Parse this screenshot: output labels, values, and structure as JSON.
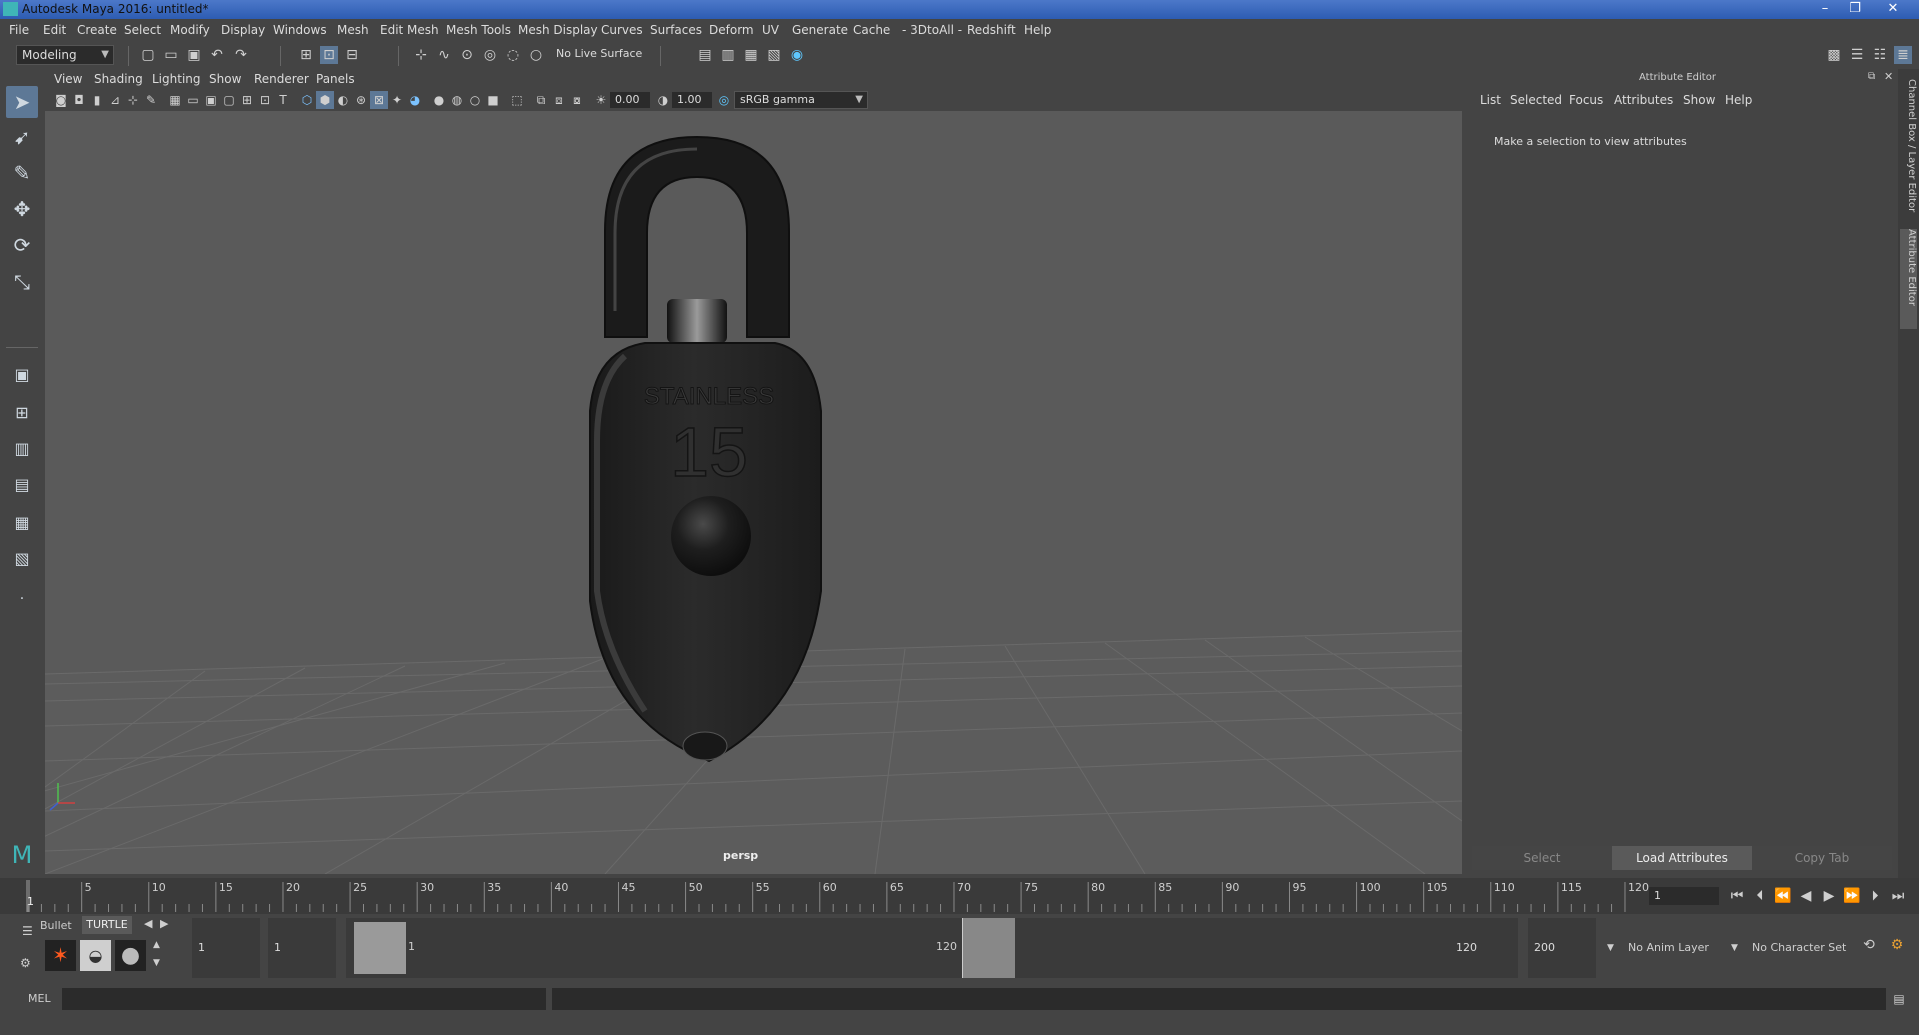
{
  "window": {
    "title": "Autodesk Maya 2016: untitled*",
    "minimize": "–",
    "restore": "❐",
    "close": "✕"
  },
  "menubar": {
    "items": [
      "File",
      "Edit",
      "Create",
      "Select",
      "Modify",
      "Display",
      "Windows",
      "Mesh",
      "Edit Mesh",
      "Mesh Tools",
      "Mesh Display",
      "Curves",
      "Surfaces",
      "Deform",
      "UV",
      "Generate",
      "Cache",
      "- 3DtoAll -",
      "Redshift",
      "Help"
    ]
  },
  "statusline": {
    "mode": "Modeling",
    "live_surface": "No Live Surface"
  },
  "panel": {
    "menus": [
      "View",
      "Shading",
      "Lighting",
      "Show",
      "Renderer",
      "Panels"
    ],
    "exposure": "0.00",
    "gamma": "1.00",
    "color_space": "sRGB gamma",
    "camera_label": "persp"
  },
  "model": {
    "text_line1": "STAINLESS",
    "text_line2": "15"
  },
  "attribute_editor": {
    "header": "Attribute Editor",
    "tabs": [
      "List",
      "Selected",
      "Focus",
      "Attributes",
      "Show",
      "Help"
    ],
    "message": "Make a selection to view attributes",
    "buttons": {
      "select": "Select",
      "load": "Load Attributes",
      "copy": "Copy Tab"
    }
  },
  "side_tabs": {
    "channel_box": "Channel Box / Layer Editor",
    "attribute_editor": "Attribute Editor"
  },
  "timeline": {
    "ticks": [
      "5",
      "10",
      "15",
      "20",
      "25",
      "30",
      "35",
      "40",
      "45",
      "50",
      "55",
      "60",
      "65",
      "70",
      "75",
      "80",
      "85",
      "90",
      "95",
      "100",
      "105",
      "110",
      "115",
      "120"
    ],
    "current_frame_marker": "1",
    "current_frame": "1"
  },
  "range": {
    "shelf_tabs": [
      "Bullet",
      "TURTLE"
    ],
    "start_field": "1",
    "playback_start": "1",
    "slider_start": "1",
    "slider_end": "120",
    "playback_end": "120",
    "end_field": "200",
    "anim_layer": "No Anim Layer",
    "character_set": "No Character Set"
  },
  "cmdline": {
    "label": "MEL"
  },
  "colors": {
    "accent": "#5d7896",
    "titlebar": "#2d5cb2",
    "viewport_bg": "#5a5a5a"
  }
}
